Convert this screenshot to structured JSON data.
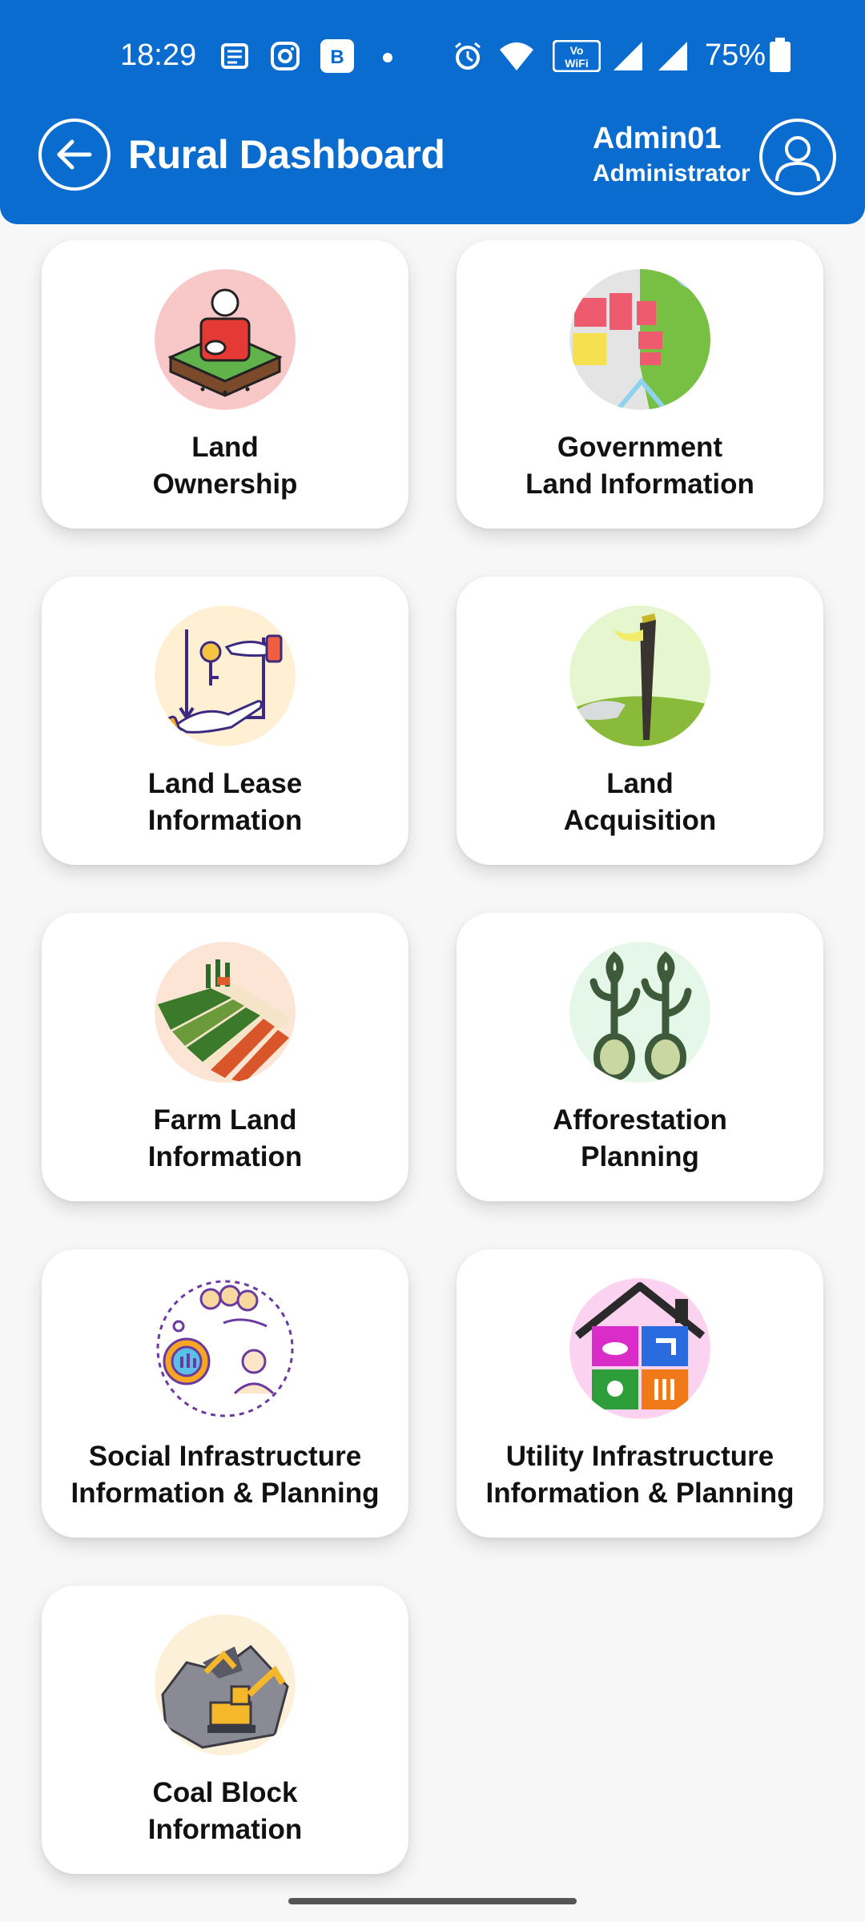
{
  "status_bar": {
    "time": "18:29",
    "battery": "75%",
    "icons": [
      "news-icon",
      "instagram-icon",
      "b-app-icon",
      "dot-icon",
      "alarm-icon",
      "wifi-icon",
      "vowifi-icon",
      "signal-icon",
      "signal-icon",
      "battery-icon"
    ]
  },
  "header": {
    "title": "Rural Dashboard",
    "user_name": "Admin01",
    "user_role": "Administrator"
  },
  "cards": [
    {
      "line1": "Land",
      "line2": "Ownership",
      "icon": "land-ownership-icon"
    },
    {
      "line1": "Government",
      "line2": "Land Information",
      "icon": "government-land-map-icon"
    },
    {
      "line1": "Land Lease",
      "line2": "Information",
      "icon": "land-lease-key-icon"
    },
    {
      "line1": "Land",
      "line2": "Acquisition",
      "icon": "land-acquisition-flag-icon"
    },
    {
      "line1": "Farm Land",
      "line2": "Information",
      "icon": "farm-land-icon"
    },
    {
      "line1": "Afforestation",
      "line2": "Planning",
      "icon": "afforestation-trees-icon"
    },
    {
      "line1": "Social Infrastructure",
      "line2": "Information & Planning",
      "icon": "social-infrastructure-icon"
    },
    {
      "line1": "Utility Infrastructure",
      "line2": "Information & Planning",
      "icon": "utility-house-icon"
    },
    {
      "line1": "Coal Block",
      "line2": "Information",
      "icon": "coal-mining-excavator-icon"
    }
  ]
}
